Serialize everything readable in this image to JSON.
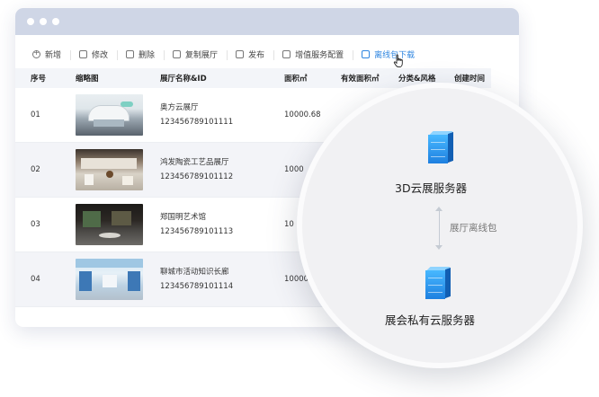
{
  "toolbar": {
    "items": [
      {
        "label": "新增",
        "icon": "add-icon"
      },
      {
        "label": "修改",
        "icon": "edit-icon"
      },
      {
        "label": "删除",
        "icon": "delete-icon"
      },
      {
        "label": "复制展厅",
        "icon": "copy-icon"
      },
      {
        "label": "发布",
        "icon": "publish-icon"
      },
      {
        "label": "增值服务配置",
        "icon": "config-icon"
      },
      {
        "label": "离线包下载",
        "icon": "download-icon",
        "active": true
      }
    ]
  },
  "table": {
    "headers": [
      "序号",
      "缩略图",
      "展厅名称&ID",
      "面积㎡",
      "有效面积㎡",
      "分类&风格",
      "创建时间"
    ],
    "rows": [
      {
        "seq": "01",
        "name": "奥方云展厅",
        "id": "123456789101111",
        "area": "10000.68"
      },
      {
        "seq": "02",
        "name": "鸿发陶瓷工艺品展厅",
        "id": "123456789101112",
        "area": "1000"
      },
      {
        "seq": "03",
        "name": "郑国明艺术馆",
        "id": "123456789101113",
        "area": "10"
      },
      {
        "seq": "04",
        "name": "聊城市活动知识长廊",
        "id": "123456789101114",
        "area": "10000"
      }
    ]
  },
  "overlay": {
    "top_server_label": "3D云展服务器",
    "bottom_server_label": "展会私有云服务器",
    "transfer_label": "展厅离线包"
  },
  "colors": {
    "accent": "#2f86e0",
    "titlebar": "#cfd6e6",
    "server": "#1e80e0"
  }
}
